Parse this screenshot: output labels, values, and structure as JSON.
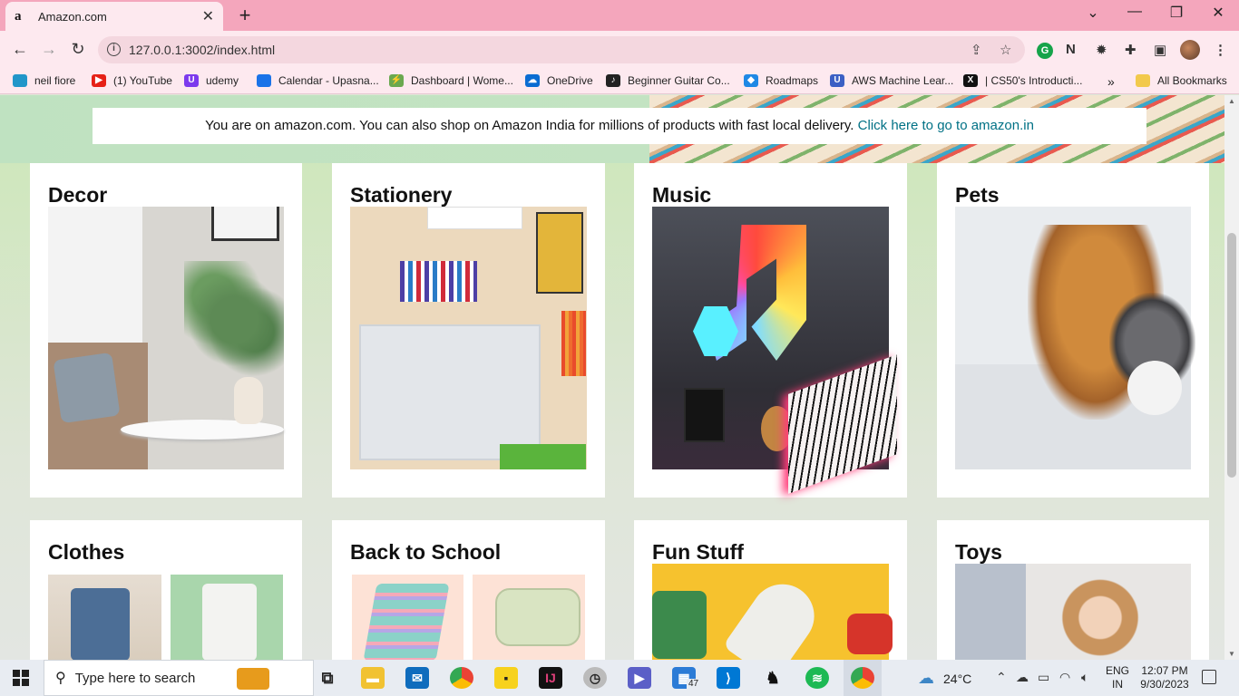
{
  "browser": {
    "tab_title": "Amazon.com",
    "tab_favicon": "a",
    "new_tab": "+",
    "url": "127.0.0.1:3002/index.html",
    "bookmarks": [
      {
        "label": "neil fiore",
        "color": "#2196c9",
        "glyph": ""
      },
      {
        "label": "(1) YouTube",
        "color": "#e62117",
        "glyph": "▶"
      },
      {
        "label": "udemy",
        "color": "#7c3aed",
        "glyph": "U"
      },
      {
        "label": "Calendar - Upasna...",
        "color": "#1a73e8",
        "glyph": ""
      },
      {
        "label": "Dashboard | Wome...",
        "color": "#6aa84f",
        "glyph": "⚡"
      },
      {
        "label": "OneDrive",
        "color": "#0a6cd2",
        "glyph": "☁"
      },
      {
        "label": "Beginner Guitar Co...",
        "color": "#222222",
        "glyph": "♪"
      },
      {
        "label": "Roadmaps",
        "color": "#1e88e5",
        "glyph": "◆"
      },
      {
        "label": "AWS Machine Lear...",
        "color": "#3b5fc4",
        "glyph": "U"
      },
      {
        "label": "| CS50's Introducti...",
        "color": "#111111",
        "glyph": "X"
      }
    ],
    "bookmarks_more": "»",
    "all_bookmarks": "All Bookmarks"
  },
  "page": {
    "banner_text": "You are on amazon.com. You can also shop on Amazon India for millions of products with fast local delivery.",
    "banner_link": "Click here to go to amazon.in",
    "cards": [
      {
        "title": "Decor"
      },
      {
        "title": "Stationery"
      },
      {
        "title": "Music"
      },
      {
        "title": "Pets"
      },
      {
        "title": "Clothes"
      },
      {
        "title": "Back to School"
      },
      {
        "title": "Fun Stuff"
      },
      {
        "title": "Toys"
      }
    ]
  },
  "taskbar": {
    "search_placeholder": "Type here to search",
    "store_badge_count": "47",
    "weather": "24°C",
    "language_line1": "ENG",
    "language_line2": "IN",
    "time": "12:07 PM",
    "date": "9/30/2023"
  },
  "colors": {
    "tabstrip": "#f4a6bc",
    "toolbar": "#fde9ef",
    "link": "#007185"
  }
}
